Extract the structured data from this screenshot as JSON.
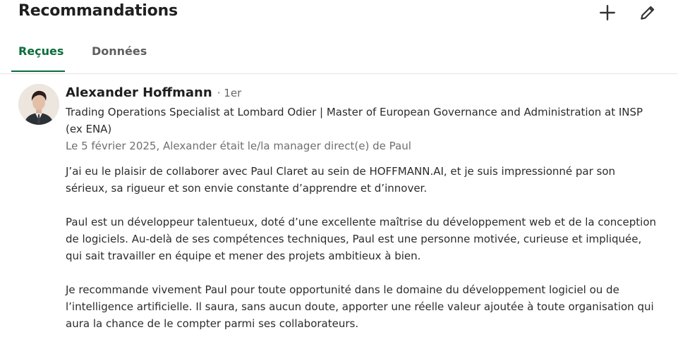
{
  "header": {
    "title": "Recommandations",
    "add_icon": "plus-icon",
    "edit_icon": "pencil-icon"
  },
  "tabs": [
    {
      "label": "Reçues",
      "active": true
    },
    {
      "label": "Données",
      "active": false
    }
  ],
  "colors": {
    "accent": "#0a6e3a",
    "text": "#191919",
    "muted": "#6f6f6f",
    "divider": "#e5e5e5"
  },
  "recommendation": {
    "avatar_icon": "profile-photo",
    "name": "Alexander Hoffmann",
    "degree": "· 1er",
    "headline": "Trading Operations Specialist at Lombard Odier | Master of European Governance and Administration at INSP (ex ENA)",
    "meta": "Le 5 février 2025, Alexander était le/la manager direct(e) de Paul",
    "paragraphs": [
      "J’ai eu le plaisir de collaborer avec Paul Claret au sein de HOFFMANN.AI, et je suis impressionné par son sérieux, sa rigueur et son envie constante d’apprendre et d’innover.",
      "Paul est un développeur talentueux, doté d’une excellente maîtrise du développement web et de la conception de logiciels. Au-delà de ses compétences techniques, Paul est une personne motivée, curieuse et impliquée, qui sait travailler en équipe et mener des projets ambitieux à bien.",
      "Je recommande vivement Paul pour toute opportunité dans le domaine du développement logiciel ou de l’intelligence artificielle. Il saura, sans aucun doute, apporter une réelle valeur ajoutée à toute organisation qui aura la chance de le compter parmi ses collaborateurs."
    ]
  }
}
